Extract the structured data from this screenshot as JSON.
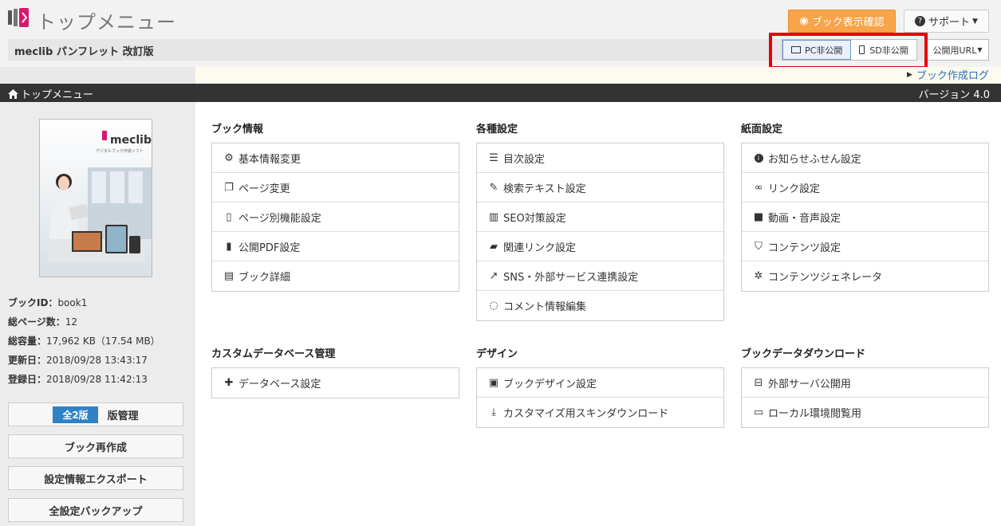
{
  "header": {
    "title": "トップメニュー",
    "preview_label": "ブック表示確認",
    "support_label": "サポート"
  },
  "book": {
    "name": "meclib パンフレット 改訂版",
    "pc_label": "PC非公開",
    "sd_label": "SD非公開",
    "url_label": "公開用URL"
  },
  "creation_log": "ブック作成ログ",
  "nav": {
    "title": "トップメニュー",
    "version": "バージョン 4.0"
  },
  "cover": {
    "brand": "meclib",
    "tagline": "デジタルブック作成ソフト"
  },
  "meta": [
    {
      "label": "ブックID：",
      "value": "book1"
    },
    {
      "label": "総ページ数：",
      "value": "12"
    },
    {
      "label": "総容量：",
      "value": "17,962 KB（17.54 MB）"
    },
    {
      "label": "更新日：",
      "value": "2018/09/28 13:43:17"
    },
    {
      "label": "登録日：",
      "value": "2018/09/28 11:42:13"
    }
  ],
  "sidebar_buttons": {
    "version_badge": "全2版",
    "version_manage": "版管理",
    "rebuild": "ブック再作成",
    "export": "設定情報エクスポート",
    "backup": "全設定バックアップ"
  },
  "sections": {
    "book_info": {
      "title": "ブック情報",
      "items": [
        "基本情報変更",
        "ページ変更",
        "ページ別機能設定",
        "公開PDF設定",
        "ブック詳細"
      ]
    },
    "settings": {
      "title": "各種設定",
      "items": [
        "目次設定",
        "検索テキスト設定",
        "SEO対策設定",
        "関連リンク設定",
        "SNS・外部サービス連携設定",
        "コメント情報編集"
      ]
    },
    "page_settings": {
      "title": "紙面設定",
      "items": [
        "お知らせふせん設定",
        "リンク設定",
        "動画・音声設定",
        "コンテンツ設定",
        "コンテンツジェネレータ"
      ]
    },
    "custom_db": {
      "title": "カスタムデータベース管理",
      "items": [
        "データベース設定"
      ]
    },
    "design": {
      "title": "デザイン",
      "items": [
        "ブックデザイン設定",
        "カスタマイズ用スキンダウンロード"
      ]
    },
    "download": {
      "title": "ブックデータダウンロード",
      "items": [
        "外部サーバ公開用",
        "ローカル環境閲覧用"
      ]
    }
  },
  "colors": {
    "accent": "#f7a44a",
    "navbar": "#333333",
    "highlight": "#e8000b",
    "link": "#2a6ebb"
  }
}
